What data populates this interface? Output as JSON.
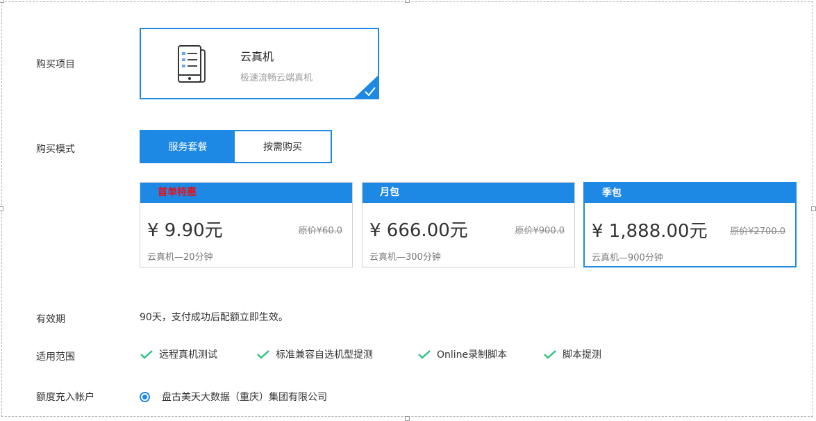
{
  "rows": {
    "product_label": "购买项目",
    "mode_label": "购买模式",
    "validity_label": "有效期",
    "scope_label": "适用范围",
    "account_label": "额度充入帐户"
  },
  "product": {
    "name": "云真机",
    "subtitle": "极速流畅云端真机",
    "icon": "phone-device-icon",
    "selected": true
  },
  "modes": [
    {
      "label": "服务套餐",
      "active": true
    },
    {
      "label": "按需购买",
      "active": false
    }
  ],
  "packages": [
    {
      "header": "首单特惠",
      "price": "¥ 9.90元",
      "original": "原价¥60.0",
      "desc": "云真机—20分钟",
      "selected": false
    },
    {
      "header": "月包",
      "price": "¥ 666.00元",
      "original": "原价¥900.0",
      "desc": "云真机—300分钟",
      "selected": false
    },
    {
      "header": "季包",
      "price": "¥ 1,888.00元",
      "original": "原价¥2700.0",
      "desc": "云真机—900分钟",
      "selected": true
    }
  ],
  "validity": "90天，支付成功后配额立即生效。",
  "scope": [
    "远程真机测试",
    "标准兼容自选机型提测",
    "Online录制脚本",
    "脚本提测"
  ],
  "account": {
    "name": "盘古美天大数据（重庆）集团有限公司",
    "selected": true
  },
  "colors": {
    "accent": "#1e88e5",
    "promo": "#e8101a",
    "check": "#2ec27e"
  }
}
